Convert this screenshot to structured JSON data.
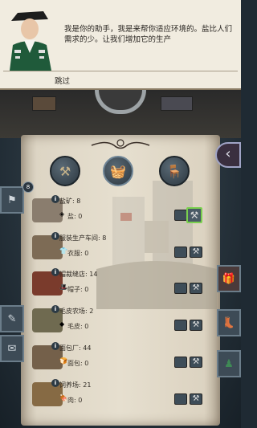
{
  "dialog": {
    "text": "我是你的助手，我是来帮你适应环境的。盐比人们需求的少。让我们增加它的生产",
    "skip_label": "跳过"
  },
  "categories": [
    {
      "name": "crossed-tools-icon",
      "active": false
    },
    {
      "name": "goods-icon",
      "active": true
    },
    {
      "name": "furniture-icon",
      "active": false
    }
  ],
  "left_badge": "8",
  "rows": [
    {
      "title": "盐矿: 8",
      "resource": "盐: 0",
      "building_color": "#8a7d6e"
    },
    {
      "title": "服装生产车间: 8",
      "resource": "衣服: 0",
      "building_color": "#7d6b55"
    },
    {
      "title": "帽裁缝店: 14",
      "resource": "帽子: 0",
      "building_color": "#7a3b2c"
    },
    {
      "title": "毛皮农场: 2",
      "resource": "毛皮: 0",
      "building_color": "#6f6a50"
    },
    {
      "title": "面包厂: 44",
      "resource": "面包: 0",
      "building_color": "#74604a"
    },
    {
      "title": "饲养场: 21",
      "resource": "肉: 0",
      "building_color": "#866a44"
    }
  ],
  "colors": {
    "selected_border": "#7ad04e",
    "parchment": "#e6dfcf"
  }
}
